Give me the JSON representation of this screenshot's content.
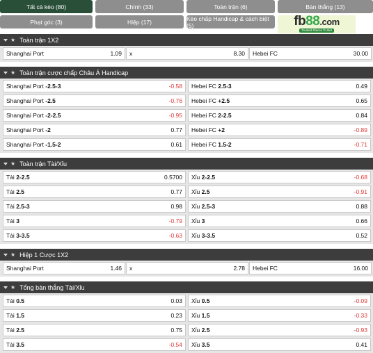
{
  "tabs": [
    {
      "label": "Tất cả kèo (80)"
    },
    {
      "label": "Chính (33)"
    },
    {
      "label": "Toàn trận (6)"
    },
    {
      "label": "Bàn thắng (13)"
    },
    {
      "label": "Phạt góc (3)"
    },
    {
      "label": "Hiệp (17)"
    },
    {
      "label": "Kèo chấp Handicap & cách biệt (5)"
    }
  ],
  "logo": {
    "main": "fb",
    "accent": "88",
    "suffix": ".com",
    "tagline": "Trusted Places To Bet"
  },
  "sections": [
    {
      "title": "Toàn trận 1X2",
      "type": "three",
      "rows": [
        [
          {
            "label": "Shanghai Port",
            "odds": "1.09"
          },
          {
            "label": "x",
            "odds": "8.30"
          },
          {
            "label": "Hebei FC",
            "odds": "30.00"
          }
        ]
      ]
    },
    {
      "title": "Toàn trận cược chấp Châu Á Handicap",
      "type": "two",
      "rows": [
        [
          {
            "label": "Shanghai Port",
            "line": "-2.5-3",
            "odds": "-0.58"
          },
          {
            "label": "Hebei FC",
            "line": "2.5-3",
            "odds": "0.49"
          }
        ],
        [
          {
            "label": "Shanghai Port",
            "line": "-2.5",
            "odds": "-0.76"
          },
          {
            "label": "Hebei FC",
            "line": "+2.5",
            "odds": "0.65"
          }
        ],
        [
          {
            "label": "Shanghai Port",
            "line": "-2-2.5",
            "odds": "-0.95"
          },
          {
            "label": "Hebei FC",
            "line": "2-2.5",
            "odds": "0.84"
          }
        ],
        [
          {
            "label": "Shanghai Port",
            "line": "-2",
            "odds": "0.77"
          },
          {
            "label": "Hebei FC",
            "line": "+2",
            "odds": "-0.89"
          }
        ],
        [
          {
            "label": "Shanghai Port",
            "line": "-1.5-2",
            "odds": "0.61"
          },
          {
            "label": "Hebei FC",
            "line": "1.5-2",
            "odds": "-0.71"
          }
        ]
      ]
    },
    {
      "title": "Toàn trận Tài/Xỉu",
      "type": "two",
      "rows": [
        [
          {
            "label": "Tài",
            "line": "2-2.5",
            "odds": "0.5700"
          },
          {
            "label": "Xỉu",
            "line": "2-2.5",
            "odds": "-0.68"
          }
        ],
        [
          {
            "label": "Tài",
            "line": "2.5",
            "odds": "0.77"
          },
          {
            "label": "Xỉu",
            "line": "2.5",
            "odds": "-0.91"
          }
        ],
        [
          {
            "label": "Tài",
            "line": "2.5-3",
            "odds": "0.98"
          },
          {
            "label": "Xỉu",
            "line": "2.5-3",
            "odds": "0.88"
          }
        ],
        [
          {
            "label": "Tài",
            "line": "3",
            "odds": "-0.79"
          },
          {
            "label": "Xỉu",
            "line": "3",
            "odds": "0.66"
          }
        ],
        [
          {
            "label": "Tài",
            "line": "3-3.5",
            "odds": "-0.63"
          },
          {
            "label": "Xỉu",
            "line": "3-3.5",
            "odds": "0.52"
          }
        ]
      ]
    },
    {
      "title": "Hiệp 1 Cược 1X2",
      "type": "three",
      "rows": [
        [
          {
            "label": "Shanghai Port",
            "odds": "1.46"
          },
          {
            "label": "x",
            "odds": "2.78"
          },
          {
            "label": "Hebei FC",
            "odds": "16.00"
          }
        ]
      ]
    },
    {
      "title": "Tổng bàn thắng Tài/Xỉu",
      "type": "two",
      "rows": [
        [
          {
            "label": "Tài",
            "line": "0.5",
            "odds": "0.03"
          },
          {
            "label": "Xỉu",
            "line": "0.5",
            "odds": "-0.09"
          }
        ],
        [
          {
            "label": "Tài",
            "line": "1.5",
            "odds": "0.23"
          },
          {
            "label": "Xỉu",
            "line": "1.5",
            "odds": "-0.33"
          }
        ],
        [
          {
            "label": "Tài",
            "line": "2.5",
            "odds": "0.75"
          },
          {
            "label": "Xỉu",
            "line": "2.5",
            "odds": "-0.93"
          }
        ],
        [
          {
            "label": "Tài",
            "line": "3.5",
            "odds": "-0.54"
          },
          {
            "label": "Xỉu",
            "line": "3.5",
            "odds": "0.41"
          }
        ]
      ]
    }
  ],
  "colors": {
    "active_tab": "#294f38",
    "tab": "#8e8e8e",
    "section_header": "#3d3d3d",
    "negative_odds": "#e23b3b",
    "logo_accent": "#35a74c"
  }
}
